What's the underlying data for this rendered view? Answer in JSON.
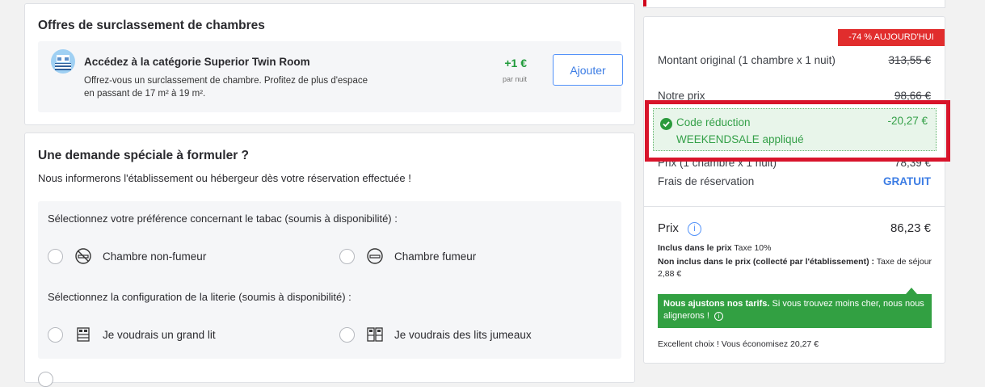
{
  "upgrade": {
    "title": "Offres de surclassement de chambres",
    "offer_name": "Accédez à la catégorie Superior Twin Room",
    "offer_desc": "Offrez-vous un surclassement de chambre. Profitez de plus d'espace en passant de 17 m² à 19 m².",
    "price": "+1 €",
    "per_night": "par nuit",
    "add_button": "Ajouter"
  },
  "special": {
    "title": "Une demande spéciale à formuler ?",
    "subtext": "Nous informerons l'établissement ou hébergeur dès votre réservation effectuée !",
    "smoking_label": "Sélectionnez votre préférence concernant le tabac (soumis à disponibilité) :",
    "non_smoking": "Chambre non-fumeur",
    "smoking": "Chambre fumeur",
    "bed_label": "Sélectionnez la configuration de la literie (soumis à disponibilité) :",
    "large_bed": "Je voudrais un grand lit",
    "twin_beds": "Je voudrais des lits jumeaux"
  },
  "summary": {
    "badge": "-74 % AUJOURD'HUI",
    "original_label": "Montant original (1 chambre x 1 nuit)",
    "original_value": "313,55 €",
    "our_price_label": "Notre prix",
    "our_price_value": "98,66 €",
    "code_line1": "Code réduction",
    "code_line2": "WEEKENDSALE appliqué",
    "code_value": "-20,27 €",
    "room_price_label": "Prix (1 chambre x 1 nuit)",
    "room_price_value": "78,39 €",
    "fee_label": "Frais de réservation",
    "fee_value": "GRATUIT",
    "total_label": "Prix",
    "total_value": "86,23 €",
    "included_label": "Inclus dans le prix",
    "included_value": "Taxe 10%",
    "not_included_label": "Non inclus dans le prix (collecté par l'établissement) :",
    "not_included_value": "Taxe de séjour 2,88 €",
    "promo_bold": "Nous ajustons nos tarifs.",
    "promo_text": "Si vous trouvez moins cher, nous nous alignerons !",
    "savings": "Excellent choix ! Vous économisez 20,27 €"
  },
  "colors": {
    "accent_blue": "#3b7ce4",
    "discount_green": "#34a048",
    "badge_red": "#e12d2d",
    "highlight_red": "#d8142b"
  }
}
